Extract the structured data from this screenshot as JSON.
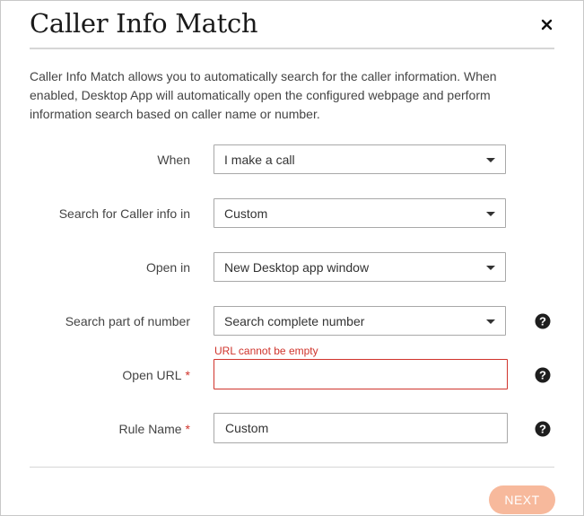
{
  "dialog": {
    "title": "Caller Info Match",
    "close_icon": "close-icon",
    "description": "Caller Info Match allows you to automatically search for the caller information. When enabled, Desktop App will automatically open the configured webpage and perform information search based on caller name or number."
  },
  "form": {
    "when": {
      "label": "When",
      "value": "I make a call"
    },
    "search_in": {
      "label": "Search for Caller info in",
      "value": "Custom"
    },
    "open_in": {
      "label": "Open in",
      "value": "New Desktop app window"
    },
    "search_part": {
      "label": "Search part of number",
      "value": "Search complete number",
      "help_icon": "help-icon"
    },
    "open_url": {
      "label": "Open URL",
      "required_mark": "*",
      "value": "",
      "error": "URL cannot be empty",
      "help_icon": "help-icon"
    },
    "rule_name": {
      "label": "Rule Name",
      "required_mark": "*",
      "value": "Custom",
      "help_icon": "help-icon"
    }
  },
  "footer": {
    "next_label": "NEXT"
  },
  "colors": {
    "error": "#d0342c",
    "next_button_disabled": "#f7b99c",
    "border": "#a8a8a8"
  }
}
